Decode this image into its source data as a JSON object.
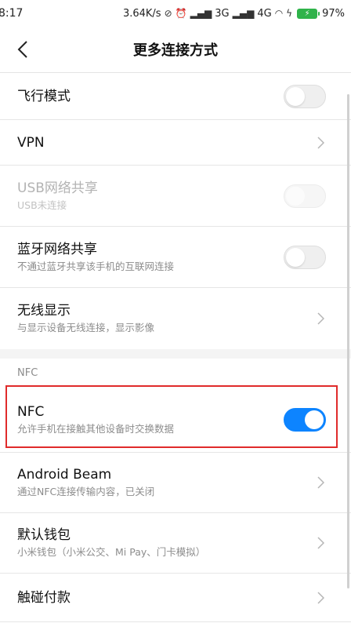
{
  "status_bar": {
    "time": "8:17",
    "net_speed": "3.64K/s",
    "signal_3g": "3G",
    "signal_4g": "4G",
    "battery_percent": "97%"
  },
  "header": {
    "title": "更多连接方式"
  },
  "items": [
    {
      "label": "飞行模式",
      "control": "toggle",
      "state": "off"
    },
    {
      "label": "VPN",
      "control": "chevron"
    },
    {
      "label": "USB网络共享",
      "sub": "USB未连接",
      "control": "toggle",
      "state": "disabled"
    },
    {
      "label": "蓝牙网络共享",
      "sub": "不通过蓝牙共享该手机的互联网连接",
      "control": "toggle",
      "state": "off"
    },
    {
      "label": "无线显示",
      "sub": "与显示设备无线连接，显示影像",
      "control": "chevron"
    }
  ],
  "nfc_section": {
    "header": "NFC",
    "items": [
      {
        "label": "NFC",
        "sub": "允许手机在接触其他设备时交换数据",
        "control": "toggle",
        "state": "on"
      },
      {
        "label": "Android Beam",
        "sub": "通过NFC连接传输内容，已关闭",
        "control": "chevron"
      },
      {
        "label": "默认钱包",
        "sub": "小米钱包（小米公交、Mi Pay、门卡模拟）",
        "control": "chevron"
      },
      {
        "label": "触碰付款",
        "control": "chevron"
      }
    ]
  },
  "colors": {
    "accent": "#0d84ff",
    "highlight": "#e02b2b"
  }
}
